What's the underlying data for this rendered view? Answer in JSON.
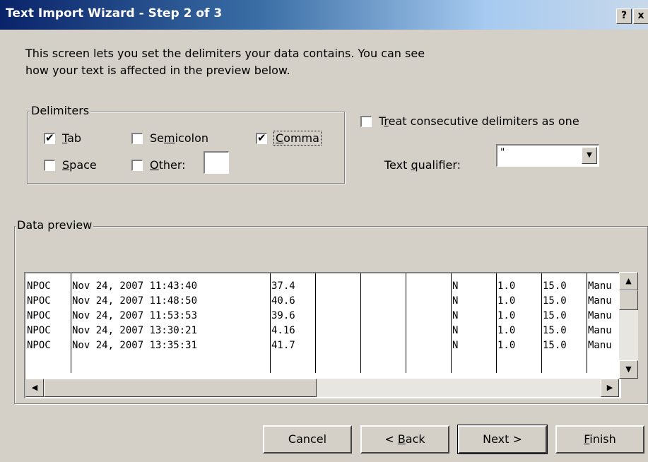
{
  "window": {
    "title": "Text Import Wizard - Step 2 of 3",
    "help_label": "?",
    "close_label": "x"
  },
  "description": {
    "line1": "This screen lets you set the delimiters your data contains.  You can see",
    "line2": "how your text is affected in the preview below."
  },
  "delimiters": {
    "legend": "Delimiters",
    "tab": {
      "label_accel": "T",
      "label_rest": "ab",
      "checked": true
    },
    "semicolon": {
      "label_pre": "Se",
      "label_accel": "m",
      "label_rest": "icolon",
      "checked": false
    },
    "comma": {
      "label_accel": "C",
      "label_rest": "omma",
      "checked": true
    },
    "space": {
      "label_accel": "S",
      "label_rest": "pace",
      "checked": false
    },
    "other": {
      "label_accel": "O",
      "label_rest": "ther:",
      "checked": false,
      "value": ""
    }
  },
  "consecutive": {
    "label_pre": "T",
    "label_accel": "r",
    "label_rest": "eat consecutive delimiters as one",
    "checked": false
  },
  "text_qualifier": {
    "label_pre": "Text ",
    "label_accel": "q",
    "label_rest": "ualifier:",
    "value": "\""
  },
  "preview": {
    "legend": "Data preview",
    "rows": [
      [
        "NPOC",
        "Nov 24, 2007 11:43:40",
        "37.4",
        "",
        "",
        "",
        "N",
        "1.0",
        "15.0",
        "Manu"
      ],
      [
        "NPOC",
        "Nov 24, 2007 11:48:50",
        "40.6",
        "",
        "",
        "",
        "N",
        "1.0",
        "15.0",
        "Manu"
      ],
      [
        "NPOC",
        "Nov 24, 2007 11:53:53",
        "39.6",
        "",
        "",
        "",
        "N",
        "1.0",
        "15.0",
        "Manu"
      ],
      [
        "NPOC",
        "Nov 24, 2007 13:30:21",
        "4.16",
        "",
        "",
        "",
        "N",
        "1.0",
        "15.0",
        "Manu"
      ],
      [
        "NPOC",
        "Nov 24, 2007 13:35:31",
        "41.7",
        "",
        "",
        "",
        "N",
        "1.0",
        "15.0",
        "Manu"
      ]
    ]
  },
  "buttons": {
    "cancel": "Cancel",
    "back_pre": "< ",
    "back_accel": "B",
    "back_rest": "ack",
    "next": "Next >",
    "finish_accel": "F",
    "finish_rest": "inish"
  }
}
